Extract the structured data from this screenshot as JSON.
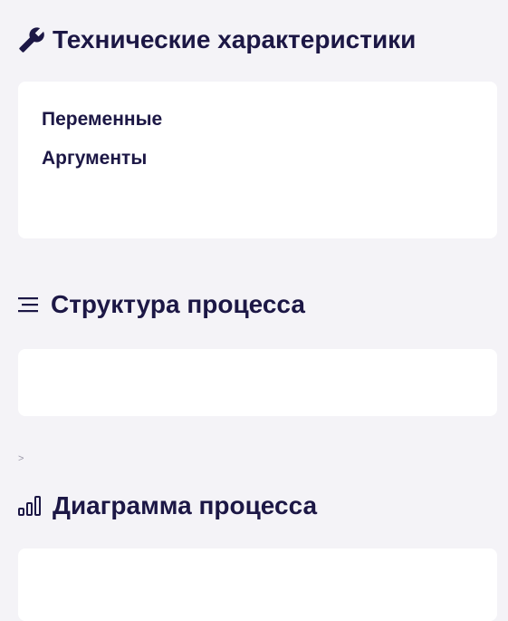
{
  "specs": {
    "title": "Технические характеристики",
    "icon": "wrench-icon",
    "items": [
      "Переменные",
      "Аргументы"
    ]
  },
  "structure": {
    "title": "Структура процесса",
    "icon": "list-lines-icon"
  },
  "expander": {
    "symbol": ">"
  },
  "diagram": {
    "title": "Диаграмма процесса",
    "icon": "bar-chart-icon"
  },
  "colors": {
    "text": "#1c1745",
    "background": "#f4f3f7",
    "card": "#ffffff"
  }
}
